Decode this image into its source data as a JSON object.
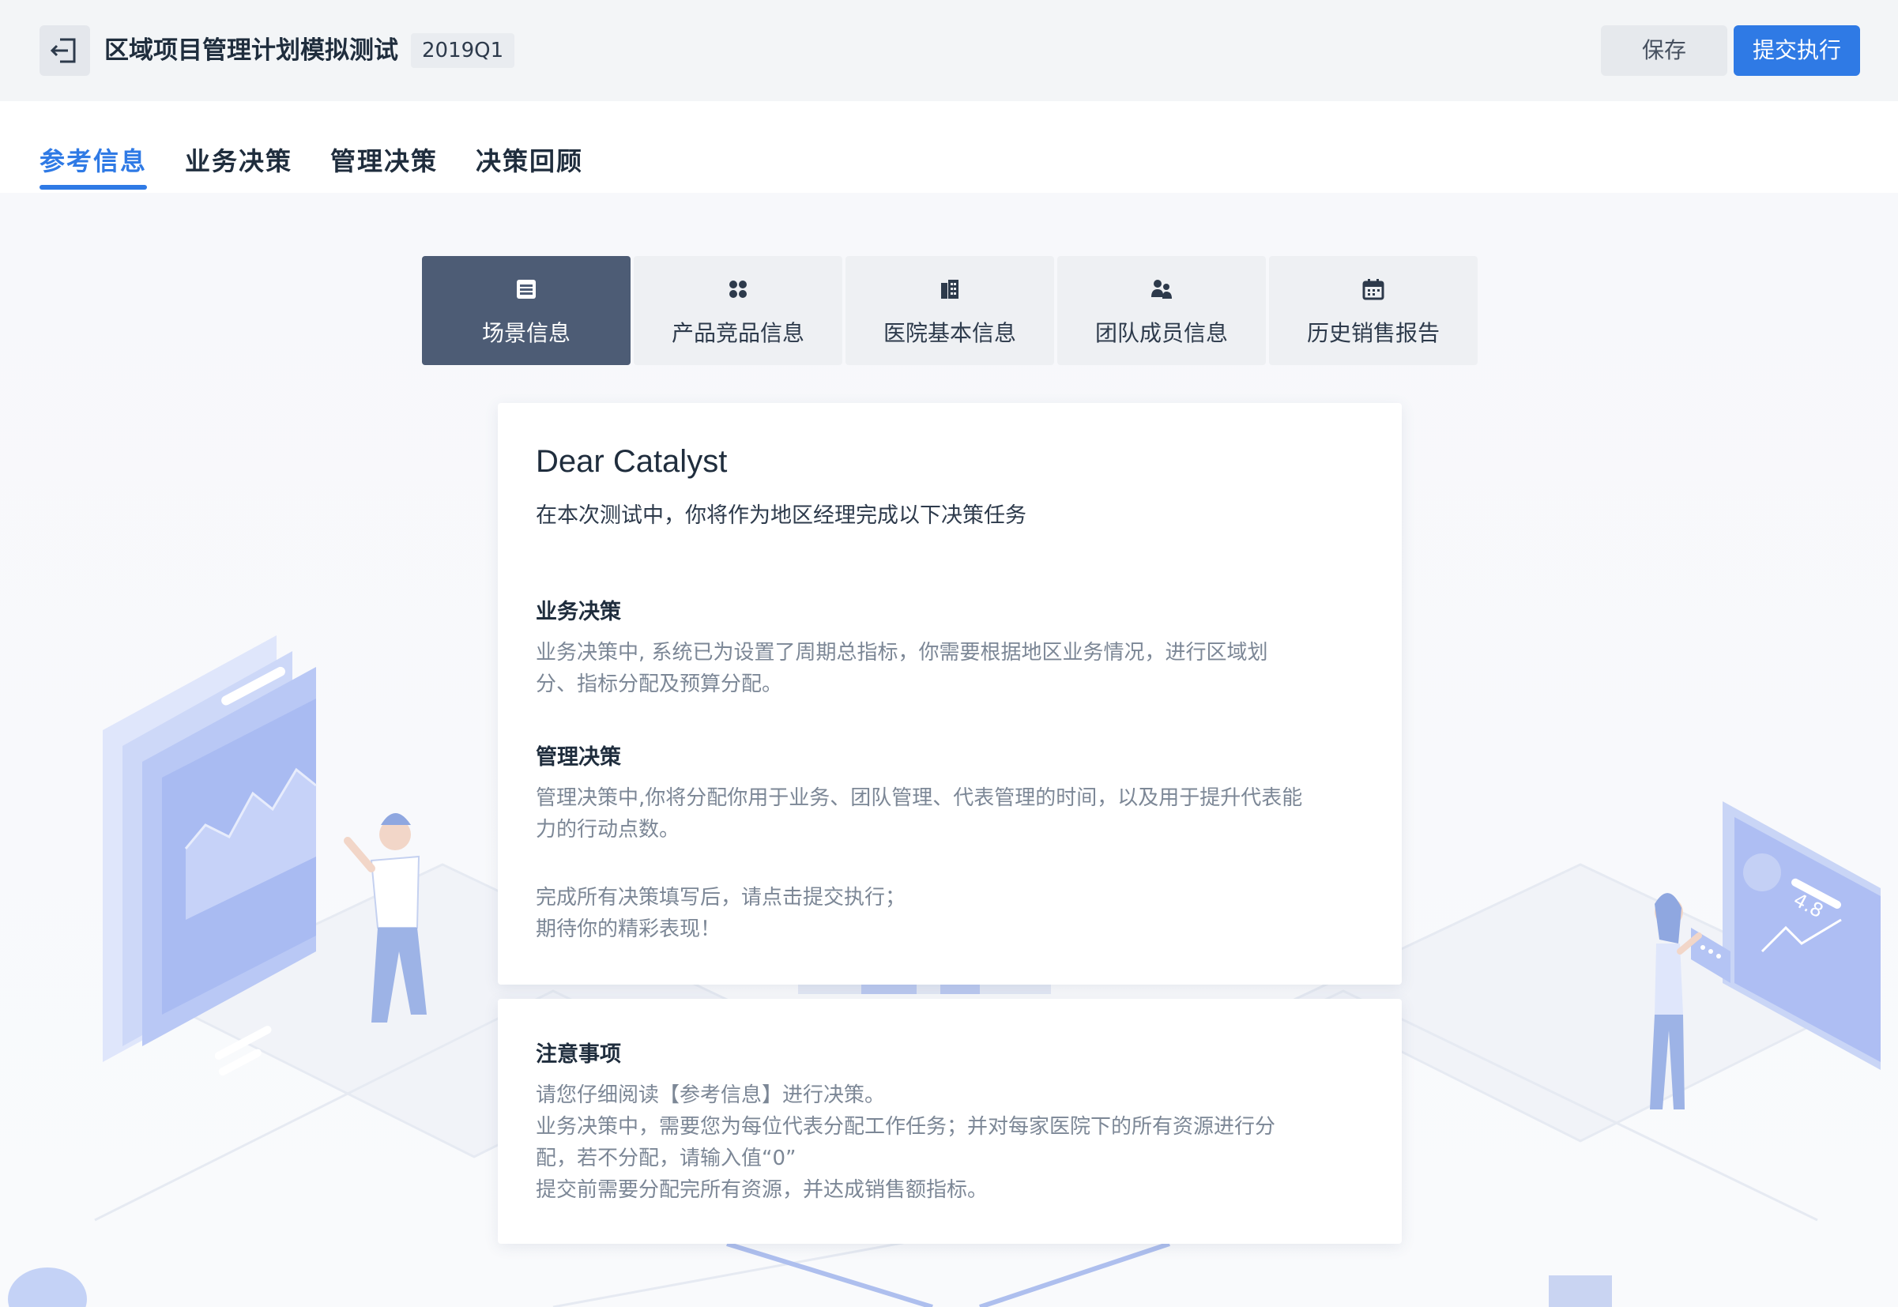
{
  "header": {
    "title": "区域项目管理计划模拟测试",
    "version": "2019Q1",
    "save_label": "保存",
    "submit_label": "提交执行"
  },
  "tabs": [
    {
      "label": "参考信息",
      "active": true
    },
    {
      "label": "业务决策",
      "active": false
    },
    {
      "label": "管理决策",
      "active": false
    },
    {
      "label": "决策回顾",
      "active": false
    }
  ],
  "subtabs": [
    {
      "label": "场景信息",
      "icon": "list-icon",
      "active": true
    },
    {
      "label": "产品竞品信息",
      "icon": "grid-icon",
      "active": false
    },
    {
      "label": "医院基本信息",
      "icon": "building-icon",
      "active": false
    },
    {
      "label": "团队成员信息",
      "icon": "team-icon",
      "active": false
    },
    {
      "label": "历史销售报告",
      "icon": "calendar-icon",
      "active": false
    }
  ],
  "intro_card": {
    "greeting": "Dear Catalyst",
    "intro": "在本次测试中，你将作为地区经理完成以下决策任务",
    "business": {
      "title": "业务决策",
      "lines": [
        "业务决策中, 系统已为设置了周期总指标，你需要根据地区业务情况，进行区域划",
        "分、指标分配及预算分配。"
      ]
    },
    "management": {
      "title": "管理决策",
      "lines": [
        "管理决策中,你将分配你用于业务、团队管理、代表管理的时间，以及用于提升代表能",
        "力的行动点数。"
      ]
    },
    "closing": [
      "完成所有决策填写后，请点击提交执行；",
      "期待你的精彩表现！"
    ]
  },
  "notice_card": {
    "title": "注意事项",
    "lines": [
      "请您仔细阅读【参考信息】进行决策。",
      "业务决策中，需要您为每位代表分配工作任务；并对每家医院下的所有资源进行分",
      "配，若不分配，请输入值“0”",
      "提交前需要分配完所有资源，并达成销售额指标。"
    ]
  },
  "decor": {
    "badge_text": "4.8"
  },
  "colors": {
    "accent": "#2f7ae5",
    "active_subtab": "#4d5c75",
    "muted_text": "#7c8796"
  }
}
